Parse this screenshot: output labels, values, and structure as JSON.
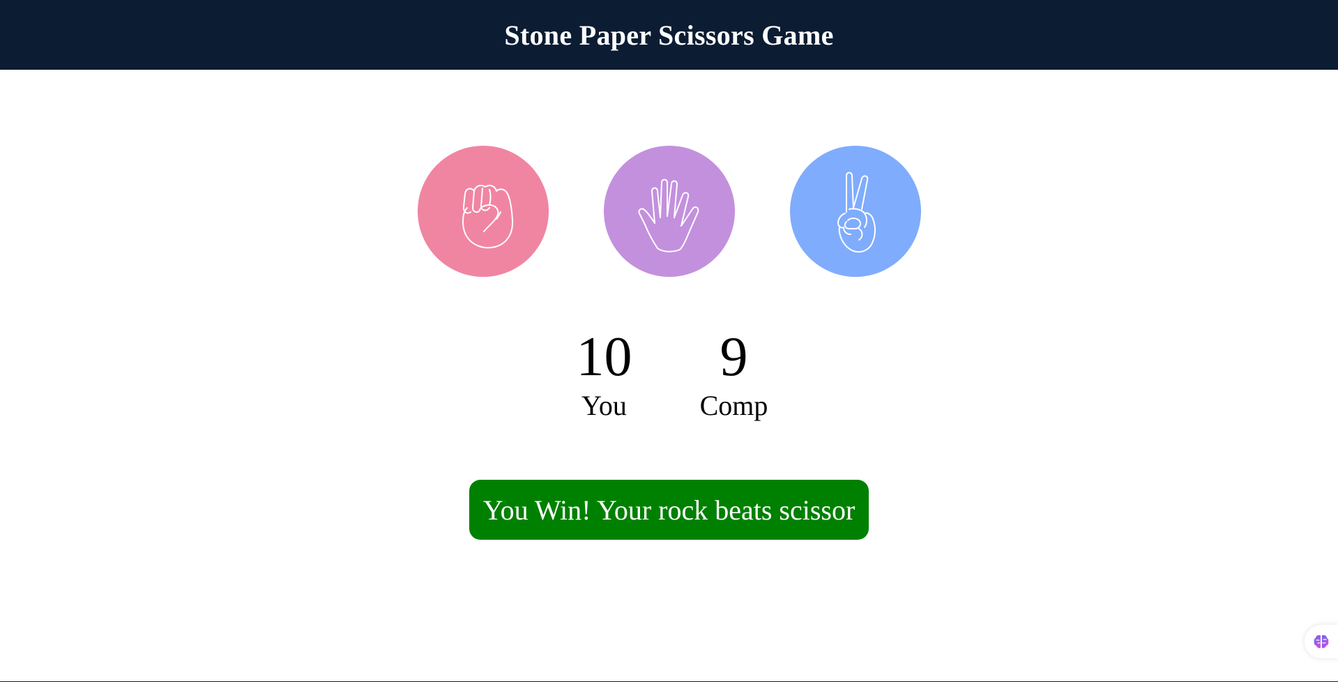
{
  "header": {
    "title": "Stone Paper Scissors Game",
    "background": "#0c1c33"
  },
  "choices": [
    {
      "id": "rock",
      "icon": "fist-icon",
      "color": "#f085a2"
    },
    {
      "id": "paper",
      "icon": "open-hand-icon",
      "color": "#c390de"
    },
    {
      "id": "scissors",
      "icon": "victory-hand-icon",
      "color": "#80acfd"
    }
  ],
  "score": {
    "user": {
      "value": "10",
      "label": "You"
    },
    "comp": {
      "value": "9",
      "label": "Comp"
    }
  },
  "message": {
    "text": "You Win! Your rock beats scissor",
    "color": "#008000"
  },
  "extension": {
    "icon": "brain-icon"
  }
}
